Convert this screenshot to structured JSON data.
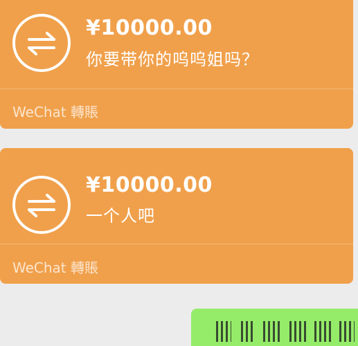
{
  "messages": [
    {
      "amount": "¥10000.00",
      "note": "你要带你的呜呜姐吗？",
      "footer": "WeChat 轉賬",
      "icon": "transfer-arrows-icon"
    },
    {
      "amount": "¥10000.00",
      "note": "一个人吧",
      "footer": "WeChat 轉賬",
      "icon": "transfer-arrows-icon"
    }
  ],
  "colors": {
    "transfer_card": "#f0a04b",
    "sent_bubble": "#95ec69",
    "background": "#ececec",
    "text": "#ffffff"
  }
}
